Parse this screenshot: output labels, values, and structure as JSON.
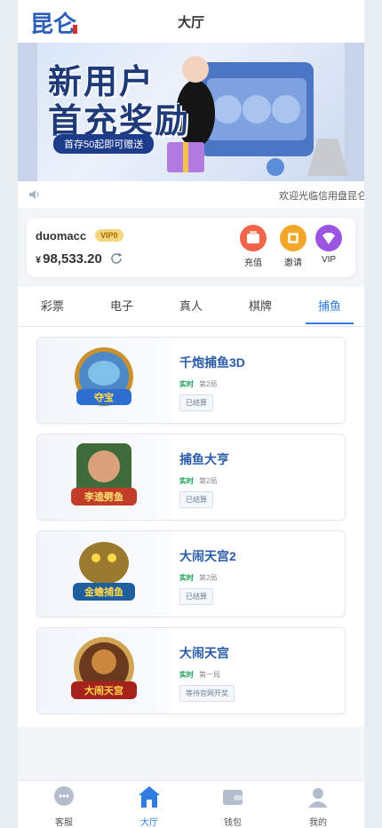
{
  "header": {
    "title": "大厅",
    "logo_text": "昆仑"
  },
  "banner": {
    "line1": "新用户",
    "line2": "首充奖励",
    "pill": "首存50起即可赠送"
  },
  "notice": {
    "icon": "speaker-icon",
    "text": "欢迎光临信用盘昆仑"
  },
  "user": {
    "username": "duomacc",
    "vip_level": "VIP0",
    "currency": "¥",
    "balance": "98,533.20",
    "actions": [
      {
        "label": "充值",
        "icon": "recharge-icon",
        "color": "#f0644a"
      },
      {
        "label": "邀请",
        "icon": "invite-icon",
        "color": "#f4a62a"
      },
      {
        "label": "VIP",
        "icon": "vip-icon",
        "color": "#9b55e0"
      }
    ]
  },
  "tabs": [
    "彩票",
    "电子",
    "真人",
    "棋牌",
    "捕鱼"
  ],
  "active_tab": "捕鱼",
  "games": [
    {
      "name": "千炮捕鱼3D",
      "live": "实时",
      "period": "第2局",
      "status": "已结算",
      "art_text": "夺宝"
    },
    {
      "name": "捕鱼大亨",
      "live": "实时",
      "period": "第2局",
      "status": "已结算",
      "art_text": "李逵劈鱼"
    },
    {
      "name": "大闹天宫2",
      "live": "实时",
      "period": "第2局",
      "status": "已结算",
      "art_text": "金蟾捕鱼"
    },
    {
      "name": "大闹天宫",
      "live": "实时",
      "period": "第一局",
      "status": "等待官网开奖",
      "art_text": "大闹天宫"
    }
  ],
  "bottom_nav": [
    {
      "label": "客服",
      "icon": "customer-service-icon"
    },
    {
      "label": "大厅",
      "icon": "home-icon"
    },
    {
      "label": "钱包",
      "icon": "wallet-icon"
    },
    {
      "label": "我的",
      "icon": "profile-icon"
    }
  ],
  "colors": {
    "accent": "#2f7de1",
    "game_title": "#2a5ca8",
    "live": "#1aa05a"
  }
}
